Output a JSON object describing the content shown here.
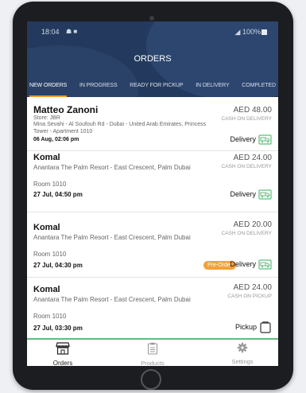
{
  "status_bar": {
    "time": "18:04",
    "icons": "☗ ■",
    "battery": "100%"
  },
  "header": {
    "title": "ORDERS"
  },
  "tabs": [
    {
      "label": "NEW ORDERS",
      "active": true
    },
    {
      "label": "IN PROGRESS",
      "active": false
    },
    {
      "label": "READY FOR PICKUP",
      "active": false
    },
    {
      "label": "IN DELIVERY",
      "active": false
    },
    {
      "label": "COMPLETED",
      "active": false
    }
  ],
  "orders": [
    {
      "customer": "Matteo Zanoni",
      "store": "Store: JBR",
      "address": "Mina Sevahi - Al Soufouh Rd - Dubai - United Arab Emirates, Princess Tower - Apartment 1010",
      "datetime": "06 Aug, 02:06 pm",
      "amount": "AED 48.00",
      "payment": "CASH ON DELIVERY",
      "method": "Delivery",
      "method_icon": "delivery-truck-icon"
    },
    {
      "customer": "Komal",
      "address": "Anantara The Palm Resort - East Crescent, Palm Dubai",
      "room": "Room 1010",
      "datetime": "27 Jul, 04:50 pm",
      "amount": "AED 24.00",
      "payment": "CASH ON DELIVERY",
      "method": "Delivery",
      "method_icon": "delivery-truck-icon"
    },
    {
      "customer": "Komal",
      "address": "Anantara The Palm Resort - East Crescent, Palm Dubai",
      "room": "Room 1010",
      "datetime": "27 Jul, 04:30 pm",
      "amount": "AED 20.00",
      "payment": "CASH ON DELIVERY",
      "badge": "Pre-Order",
      "method": "Delivery",
      "method_icon": "delivery-truck-icon"
    },
    {
      "customer": "Komal",
      "address": "Anantara The Palm Resort - East Crescent, Palm Dubai",
      "room": "Room 1010",
      "datetime": "27 Jul, 03:30 pm",
      "amount": "AED 24.00",
      "payment": "CASH ON PICKUP",
      "method": "Pickup",
      "method_icon": "shopping-bag-icon"
    }
  ],
  "bottom_nav": [
    {
      "label": "Orders",
      "icon": "storefront-icon",
      "active": true
    },
    {
      "label": "Products",
      "icon": "clipboard-icon",
      "active": false
    },
    {
      "label": "Settings",
      "icon": "gear-icon",
      "active": false
    }
  ],
  "colors": {
    "header_bg": "#233a5e",
    "tab_indicator": "#f39a2c",
    "preorder_badge": "#f2a13c",
    "bottom_border": "#5fbd7e"
  }
}
